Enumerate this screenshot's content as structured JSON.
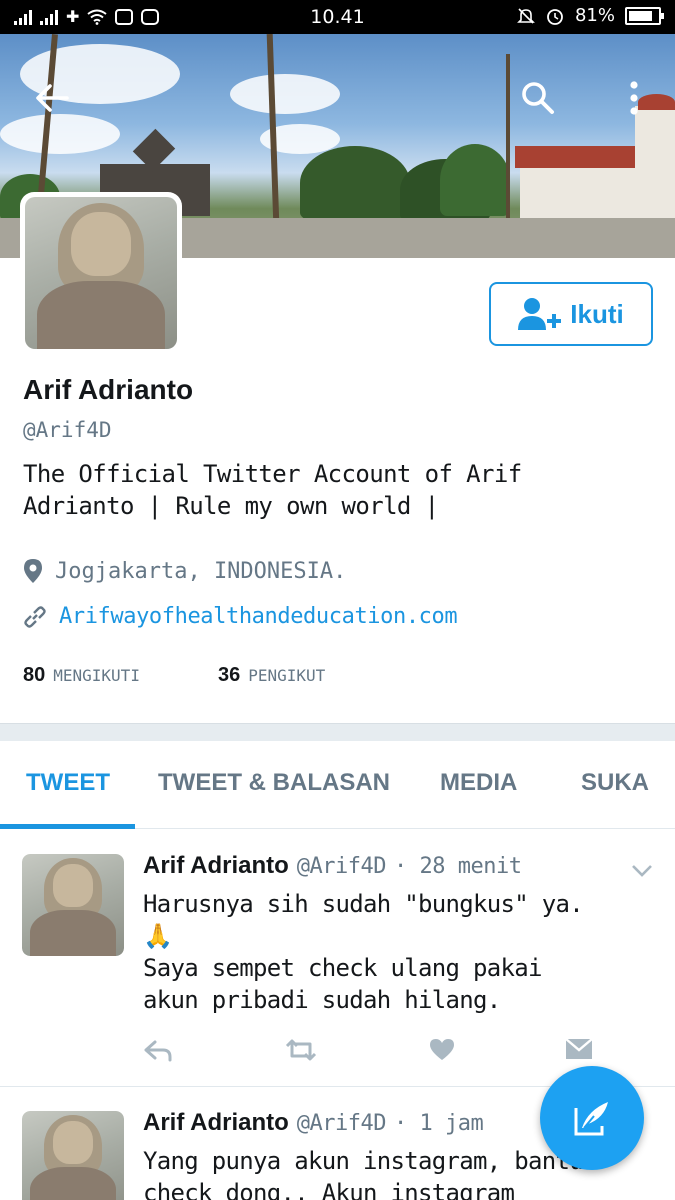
{
  "status_bar": {
    "time": "10.41",
    "battery": "81%",
    "battery_level": 0.81
  },
  "profile": {
    "name": "Arif Adrianto",
    "handle": "@Arif4D",
    "bio_line1": "The Official Twitter Account of Arif",
    "bio_line2": "Adrianto | Rule my own world |",
    "location": "Jogjakarta, INDONESIA.",
    "website": "Arifwayofhealthandeducation.com",
    "following_count": "80",
    "following_label": "MENGIKUTI",
    "followers_count": "36",
    "followers_label": "PENGIKUT",
    "follow_button": "Ikuti"
  },
  "tabs": [
    {
      "label": "TWEET",
      "active": true
    },
    {
      "label": "TWEET & BALASAN",
      "active": false
    },
    {
      "label": "MEDIA",
      "active": false
    },
    {
      "label": "SUKA",
      "active": false
    }
  ],
  "tweets": [
    {
      "name": "Arif Adrianto",
      "handle": "@Arif4D",
      "time": "· 28 menit",
      "line1": "Harusnya sih sudah \"bungkus\" ya.",
      "emoji": "🙏",
      "line2": "Saya sempet check ulang pakai",
      "line3": "akun pribadi sudah hilang."
    },
    {
      "name": "Arif Adrianto",
      "handle": "@Arif4D",
      "time": "· 1 jam",
      "line1": "Yang punya akun instagram, bantu",
      "line2": "check dong.. Akun instagram"
    }
  ],
  "icons": {
    "back": "back-arrow-icon",
    "search": "search-icon",
    "more": "more-vertical-icon",
    "compose": "compose-tweet-icon"
  },
  "colors": {
    "accent": "#1b95e0",
    "muted": "#657786"
  }
}
